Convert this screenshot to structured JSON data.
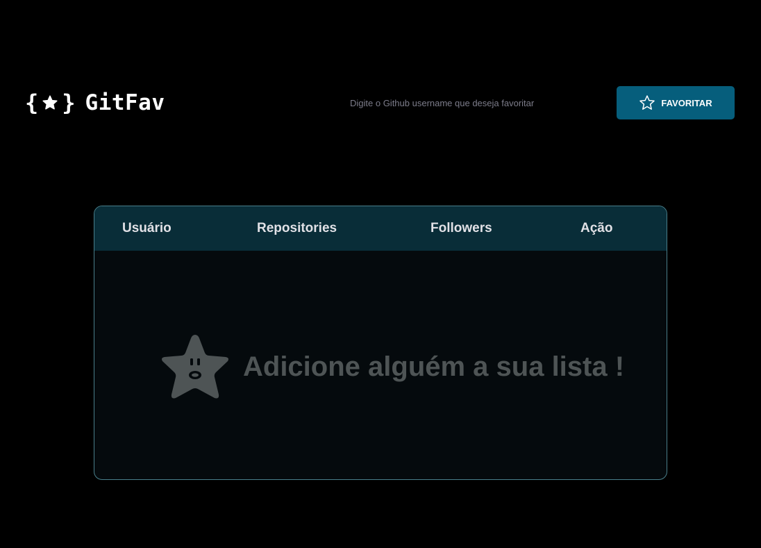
{
  "header": {
    "logo_brace_open": "{",
    "logo_brace_close": "}",
    "logo_text": "GitFav",
    "logo_icon": "star-icon",
    "search": {
      "placeholder": "Digite o Github username que deseja favoritar",
      "value": ""
    },
    "favorite_button": {
      "label": "FAVORITAR",
      "icon": "star-outline-icon"
    }
  },
  "table": {
    "columns": [
      "Usuário",
      "Repositories",
      "Followers",
      "Ação"
    ],
    "rows": [],
    "empty_state": {
      "icon": "surprised-star-icon",
      "message": "Adicione alguém a sua lista !"
    }
  },
  "colors": {
    "background": "#000000",
    "button": "#065e7c",
    "table_header": "#092d38",
    "table_body": "#050a0d",
    "table_border": "#4a808c",
    "empty_text": "#4e5455"
  }
}
